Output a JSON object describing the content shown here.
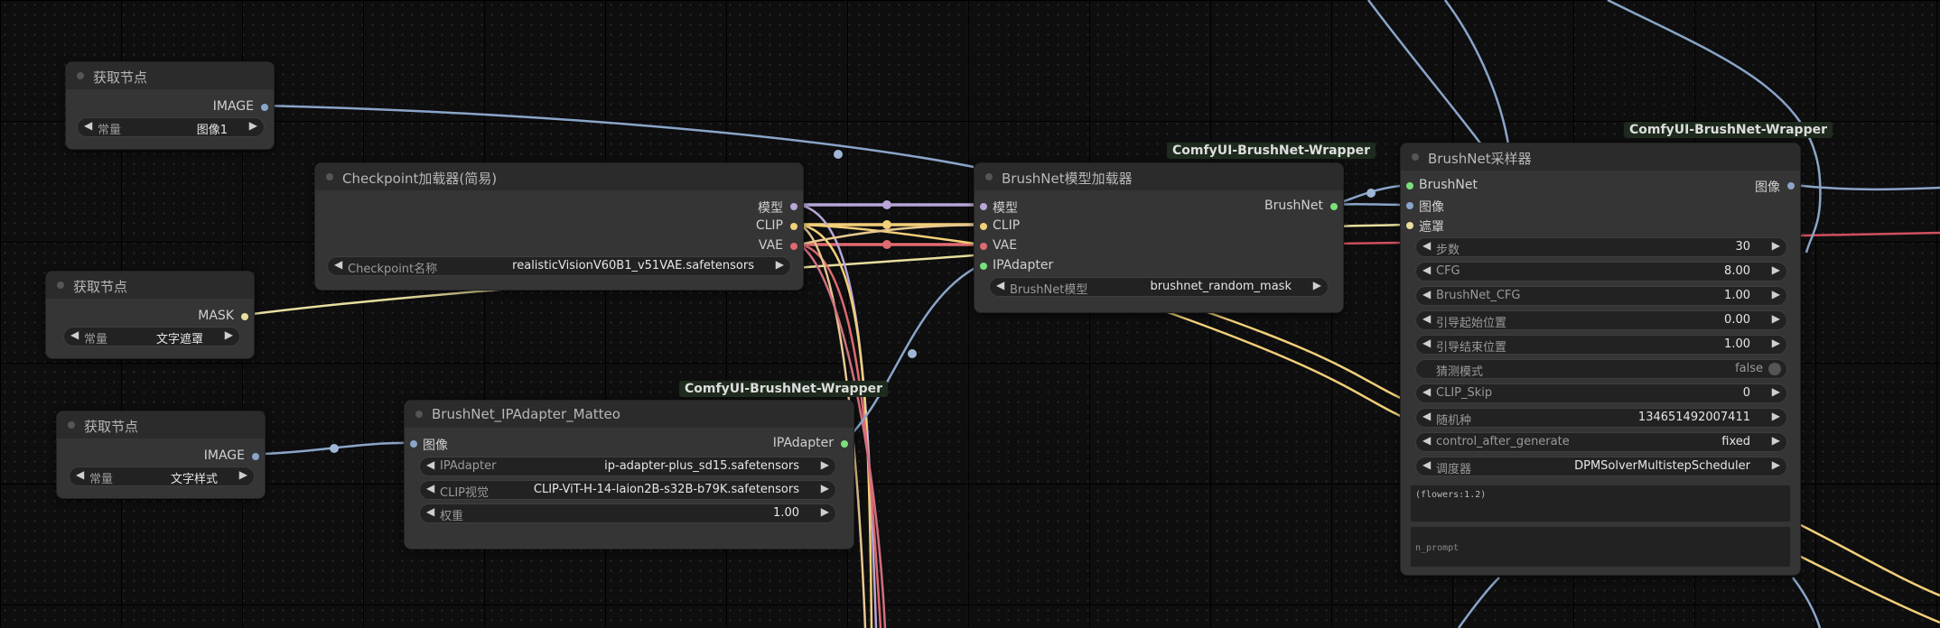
{
  "nodes": {
    "get1": {
      "title": "获取节点",
      "out": "IMAGE",
      "mode": "常量",
      "value": "图像1"
    },
    "get2": {
      "title": "获取节点",
      "out": "MASK",
      "mode": "常量",
      "value": "文字遮罩"
    },
    "get3": {
      "title": "获取节点",
      "out": "IMAGE",
      "mode": "常量",
      "value": "文字样式"
    },
    "checkpoint": {
      "title": "Checkpoint加载器(简易)",
      "outputs": [
        "模型",
        "CLIP",
        "VAE"
      ],
      "widget_label": "Checkpoint名称",
      "widget_value": "realisticVisionV60B1_v51VAE.safetensors"
    },
    "ipadapter": {
      "badge": "ComfyUI-BrushNet-Wrapper",
      "title": "BrushNet_IPAdapter_Matteo",
      "input": "图像",
      "output": "IPAdapter",
      "widgets": [
        {
          "label": "IPAdapter",
          "value": "ip-adapter-plus_sd15.safetensors"
        },
        {
          "label": "CLIP视觉",
          "value": "CLIP-ViT-H-14-laion2B-s32B-b79K.safetensors"
        },
        {
          "label": "权重",
          "value": "1.00"
        }
      ]
    },
    "loader": {
      "badge": "ComfyUI-BrushNet-Wrapper",
      "title": "BrushNet模型加载器",
      "inputs": [
        "模型",
        "CLIP",
        "VAE",
        "IPAdapter"
      ],
      "output": "BrushNet",
      "widget_label": "BrushNet模型",
      "widget_value": "brushnet_random_mask"
    },
    "sampler": {
      "badge": "ComfyUI-BrushNet-Wrapper",
      "title": "BrushNet采样器",
      "inputs": [
        "BrushNet",
        "图像",
        "遮罩"
      ],
      "output": "图像",
      "widgets": [
        {
          "label": "步数",
          "value": "30"
        },
        {
          "label": "CFG",
          "value": "8.00"
        },
        {
          "label": "BrushNet_CFG",
          "value": "1.00"
        },
        {
          "label": "引导起始位置",
          "value": "0.00"
        },
        {
          "label": "引导结束位置",
          "value": "1.00"
        },
        {
          "label": "猜测模式",
          "value": "false",
          "toggle": true
        },
        {
          "label": "CLIP_Skip",
          "value": "0"
        },
        {
          "label": "随机种",
          "value": "134651492007411"
        },
        {
          "label": "control_after_generate",
          "value": "fixed"
        },
        {
          "label": "调度器",
          "value": "DPMSolverMultistepScheduler"
        }
      ],
      "prompt": "(flowers:1.2)",
      "n_prompt": "n_prompt"
    }
  },
  "colors": {
    "image": "#8aa5c8",
    "mask": "#e8df9e",
    "model": "#b8a6d9",
    "clip": "#f2d079",
    "vae": "#e06a70",
    "ipadapter": "#7be07b",
    "brushnet": "#7be07b",
    "red_link": "#d05060"
  }
}
